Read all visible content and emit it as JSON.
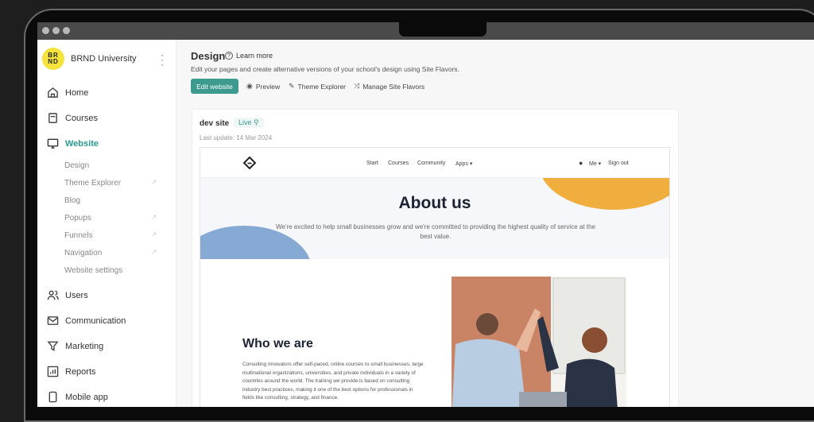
{
  "window": {
    "dots": 3
  },
  "sidebar": {
    "brand": {
      "logo_text": "BR ND",
      "name": "BRND University",
      "menu_icon": "kebab-icon"
    },
    "items": [
      {
        "label": "Home",
        "icon": "home-icon"
      },
      {
        "label": "Courses",
        "icon": "book-icon"
      },
      {
        "label": "Website",
        "icon": "monitor-icon",
        "active": true
      },
      {
        "label": "Users",
        "icon": "users-icon"
      },
      {
        "label": "Communication",
        "icon": "mail-icon"
      },
      {
        "label": "Marketing",
        "icon": "funnel-icon"
      },
      {
        "label": "Reports",
        "icon": "chart-icon"
      },
      {
        "label": "Mobile app",
        "icon": "phone-icon"
      }
    ],
    "website_sub": [
      {
        "label": "Design",
        "external": false
      },
      {
        "label": "Theme Explorer",
        "external": true
      },
      {
        "label": "Blog",
        "external": false
      },
      {
        "label": "Popups",
        "external": true
      },
      {
        "label": "Funnels",
        "external": true
      },
      {
        "label": "Navigation",
        "external": true
      },
      {
        "label": "Website settings",
        "external": false
      }
    ]
  },
  "header": {
    "title": "Design",
    "learn_more": "Learn more",
    "description": "Edit your pages and create alternative versions of your school's design using Site Flavors.",
    "edit_button": "Edit website",
    "actions": [
      {
        "label": "Preview",
        "icon": "eye-icon"
      },
      {
        "label": "Theme Explorer",
        "icon": "pencil-icon"
      },
      {
        "label": "Manage Site Flavors",
        "icon": "flavors-icon"
      }
    ],
    "accent": "#3d9a8f"
  },
  "site_card": {
    "name": "dev site",
    "status": "Live",
    "last_update": "Last update: 14 Mar 2024"
  },
  "preview": {
    "nav": {
      "links": [
        "Start",
        "Courses",
        "Community",
        "Apps ▾"
      ],
      "me": "Me ▾",
      "sign_out": "Sign out"
    },
    "hero": {
      "title": "About us",
      "subtitle": "We're excited to help small businesses grow and we're committed to providing the highest quality of service at the best value."
    },
    "who": {
      "title": "Who we are",
      "body": "Consulting Innovators offer self-paced, online courses to small businesses, large multinational organizations, universities, and private individuals in a variety of countries around the world. The training we provide is based on consulting industry best practices, making it one of the best options for professionals in fields like consulting, strategy, and finance."
    }
  }
}
